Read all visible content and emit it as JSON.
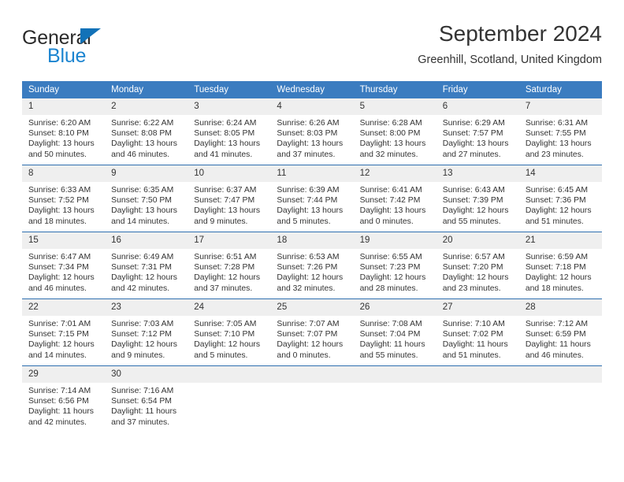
{
  "logo": {
    "word_top": "General",
    "word_bottom": "Blue",
    "triangle_color": "#1272b8",
    "blue_color": "#1b84d0"
  },
  "header": {
    "title": "September 2024",
    "subtitle": "Greenhill, Scotland, United Kingdom",
    "header_bg": "#3b7cc0",
    "header_text_color": "#ffffff",
    "row_divider_color": "#2f6fb0",
    "daynum_bg": "#efefef"
  },
  "weekday_headers": [
    "Sunday",
    "Monday",
    "Tuesday",
    "Wednesday",
    "Thursday",
    "Friday",
    "Saturday"
  ],
  "weeks": [
    [
      {
        "day": "1",
        "sunrise": "Sunrise: 6:20 AM",
        "sunset": "Sunset: 8:10 PM",
        "daylight1": "Daylight: 13 hours",
        "daylight2": "and 50 minutes."
      },
      {
        "day": "2",
        "sunrise": "Sunrise: 6:22 AM",
        "sunset": "Sunset: 8:08 PM",
        "daylight1": "Daylight: 13 hours",
        "daylight2": "and 46 minutes."
      },
      {
        "day": "3",
        "sunrise": "Sunrise: 6:24 AM",
        "sunset": "Sunset: 8:05 PM",
        "daylight1": "Daylight: 13 hours",
        "daylight2": "and 41 minutes."
      },
      {
        "day": "4",
        "sunrise": "Sunrise: 6:26 AM",
        "sunset": "Sunset: 8:03 PM",
        "daylight1": "Daylight: 13 hours",
        "daylight2": "and 37 minutes."
      },
      {
        "day": "5",
        "sunrise": "Sunrise: 6:28 AM",
        "sunset": "Sunset: 8:00 PM",
        "daylight1": "Daylight: 13 hours",
        "daylight2": "and 32 minutes."
      },
      {
        "day": "6",
        "sunrise": "Sunrise: 6:29 AM",
        "sunset": "Sunset: 7:57 PM",
        "daylight1": "Daylight: 13 hours",
        "daylight2": "and 27 minutes."
      },
      {
        "day": "7",
        "sunrise": "Sunrise: 6:31 AM",
        "sunset": "Sunset: 7:55 PM",
        "daylight1": "Daylight: 13 hours",
        "daylight2": "and 23 minutes."
      }
    ],
    [
      {
        "day": "8",
        "sunrise": "Sunrise: 6:33 AM",
        "sunset": "Sunset: 7:52 PM",
        "daylight1": "Daylight: 13 hours",
        "daylight2": "and 18 minutes."
      },
      {
        "day": "9",
        "sunrise": "Sunrise: 6:35 AM",
        "sunset": "Sunset: 7:50 PM",
        "daylight1": "Daylight: 13 hours",
        "daylight2": "and 14 minutes."
      },
      {
        "day": "10",
        "sunrise": "Sunrise: 6:37 AM",
        "sunset": "Sunset: 7:47 PM",
        "daylight1": "Daylight: 13 hours",
        "daylight2": "and 9 minutes."
      },
      {
        "day": "11",
        "sunrise": "Sunrise: 6:39 AM",
        "sunset": "Sunset: 7:44 PM",
        "daylight1": "Daylight: 13 hours",
        "daylight2": "and 5 minutes."
      },
      {
        "day": "12",
        "sunrise": "Sunrise: 6:41 AM",
        "sunset": "Sunset: 7:42 PM",
        "daylight1": "Daylight: 13 hours",
        "daylight2": "and 0 minutes."
      },
      {
        "day": "13",
        "sunrise": "Sunrise: 6:43 AM",
        "sunset": "Sunset: 7:39 PM",
        "daylight1": "Daylight: 12 hours",
        "daylight2": "and 55 minutes."
      },
      {
        "day": "14",
        "sunrise": "Sunrise: 6:45 AM",
        "sunset": "Sunset: 7:36 PM",
        "daylight1": "Daylight: 12 hours",
        "daylight2": "and 51 minutes."
      }
    ],
    [
      {
        "day": "15",
        "sunrise": "Sunrise: 6:47 AM",
        "sunset": "Sunset: 7:34 PM",
        "daylight1": "Daylight: 12 hours",
        "daylight2": "and 46 minutes."
      },
      {
        "day": "16",
        "sunrise": "Sunrise: 6:49 AM",
        "sunset": "Sunset: 7:31 PM",
        "daylight1": "Daylight: 12 hours",
        "daylight2": "and 42 minutes."
      },
      {
        "day": "17",
        "sunrise": "Sunrise: 6:51 AM",
        "sunset": "Sunset: 7:28 PM",
        "daylight1": "Daylight: 12 hours",
        "daylight2": "and 37 minutes."
      },
      {
        "day": "18",
        "sunrise": "Sunrise: 6:53 AM",
        "sunset": "Sunset: 7:26 PM",
        "daylight1": "Daylight: 12 hours",
        "daylight2": "and 32 minutes."
      },
      {
        "day": "19",
        "sunrise": "Sunrise: 6:55 AM",
        "sunset": "Sunset: 7:23 PM",
        "daylight1": "Daylight: 12 hours",
        "daylight2": "and 28 minutes."
      },
      {
        "day": "20",
        "sunrise": "Sunrise: 6:57 AM",
        "sunset": "Sunset: 7:20 PM",
        "daylight1": "Daylight: 12 hours",
        "daylight2": "and 23 minutes."
      },
      {
        "day": "21",
        "sunrise": "Sunrise: 6:59 AM",
        "sunset": "Sunset: 7:18 PM",
        "daylight1": "Daylight: 12 hours",
        "daylight2": "and 18 minutes."
      }
    ],
    [
      {
        "day": "22",
        "sunrise": "Sunrise: 7:01 AM",
        "sunset": "Sunset: 7:15 PM",
        "daylight1": "Daylight: 12 hours",
        "daylight2": "and 14 minutes."
      },
      {
        "day": "23",
        "sunrise": "Sunrise: 7:03 AM",
        "sunset": "Sunset: 7:12 PM",
        "daylight1": "Daylight: 12 hours",
        "daylight2": "and 9 minutes."
      },
      {
        "day": "24",
        "sunrise": "Sunrise: 7:05 AM",
        "sunset": "Sunset: 7:10 PM",
        "daylight1": "Daylight: 12 hours",
        "daylight2": "and 5 minutes."
      },
      {
        "day": "25",
        "sunrise": "Sunrise: 7:07 AM",
        "sunset": "Sunset: 7:07 PM",
        "daylight1": "Daylight: 12 hours",
        "daylight2": "and 0 minutes."
      },
      {
        "day": "26",
        "sunrise": "Sunrise: 7:08 AM",
        "sunset": "Sunset: 7:04 PM",
        "daylight1": "Daylight: 11 hours",
        "daylight2": "and 55 minutes."
      },
      {
        "day": "27",
        "sunrise": "Sunrise: 7:10 AM",
        "sunset": "Sunset: 7:02 PM",
        "daylight1": "Daylight: 11 hours",
        "daylight2": "and 51 minutes."
      },
      {
        "day": "28",
        "sunrise": "Sunrise: 7:12 AM",
        "sunset": "Sunset: 6:59 PM",
        "daylight1": "Daylight: 11 hours",
        "daylight2": "and 46 minutes."
      }
    ],
    [
      {
        "day": "29",
        "sunrise": "Sunrise: 7:14 AM",
        "sunset": "Sunset: 6:56 PM",
        "daylight1": "Daylight: 11 hours",
        "daylight2": "and 42 minutes."
      },
      {
        "day": "30",
        "sunrise": "Sunrise: 7:16 AM",
        "sunset": "Sunset: 6:54 PM",
        "daylight1": "Daylight: 11 hours",
        "daylight2": "and 37 minutes."
      },
      {
        "day": "",
        "sunrise": "",
        "sunset": "",
        "daylight1": "",
        "daylight2": ""
      },
      {
        "day": "",
        "sunrise": "",
        "sunset": "",
        "daylight1": "",
        "daylight2": ""
      },
      {
        "day": "",
        "sunrise": "",
        "sunset": "",
        "daylight1": "",
        "daylight2": ""
      },
      {
        "day": "",
        "sunrise": "",
        "sunset": "",
        "daylight1": "",
        "daylight2": ""
      },
      {
        "day": "",
        "sunrise": "",
        "sunset": "",
        "daylight1": "",
        "daylight2": ""
      }
    ]
  ]
}
